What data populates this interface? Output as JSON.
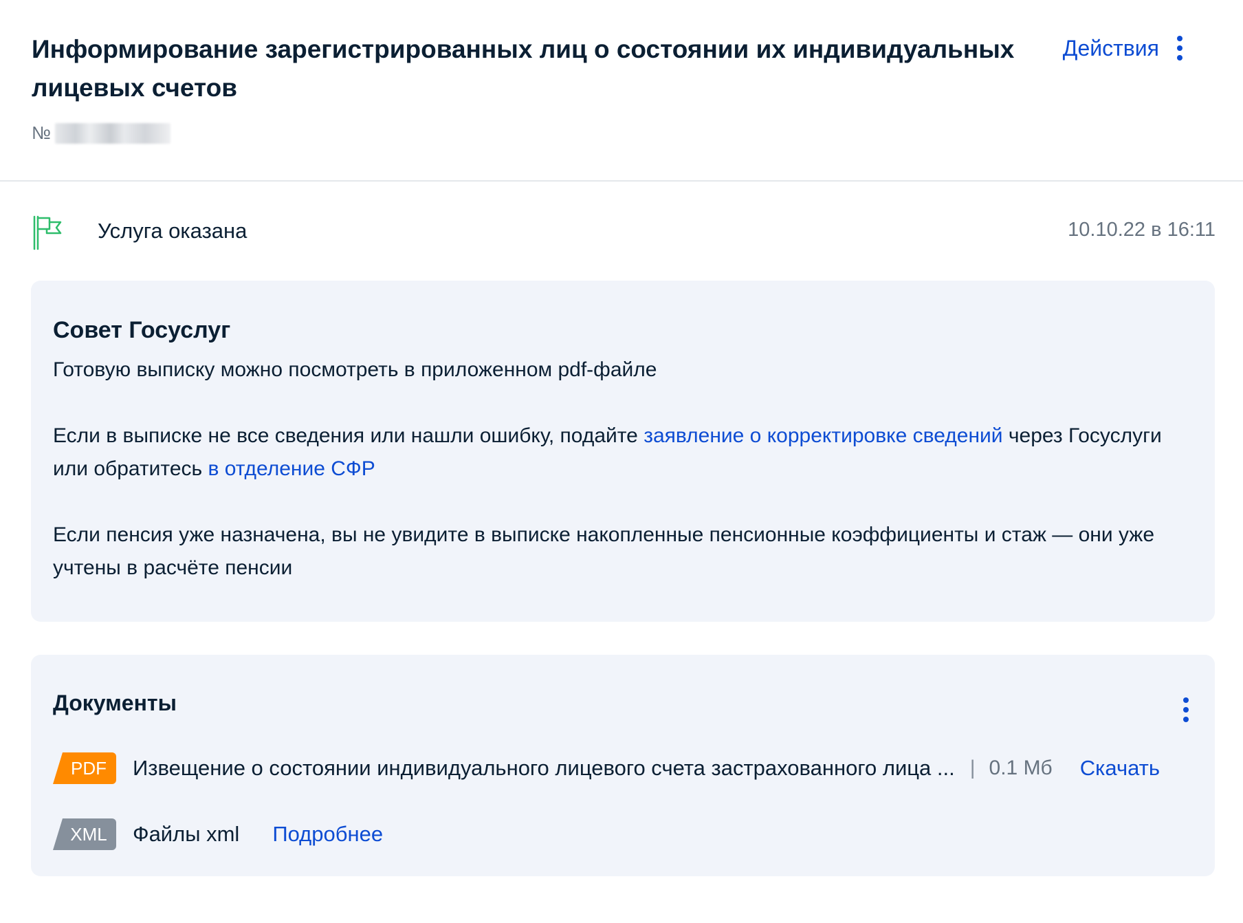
{
  "header": {
    "title": "Информирование зарегистрированных лиц о состоянии их индивидуальных лицевых счетов",
    "number_label": "№",
    "actions_label": "Действия"
  },
  "status": {
    "text": "Услуга оказана",
    "date": "10.10.22 в 16:11",
    "icon": "flag-icon",
    "icon_color": "#2ebd6b"
  },
  "advice": {
    "title": "Совет Госуслуг",
    "p1": "Готовую выписку можно посмотреть в приложенном pdf-файле",
    "p2_before": "Если в выписке не все сведения или нашли ошибку, подайте ",
    "p2_link1": "заявление о корректировке сведений",
    "p2_middle": " через Госуслуги или обратитесь ",
    "p2_link2": "в отделение СФР",
    "p3": "Если пенсия уже назначена, вы не увидите в выписке накопленные пенсионные коэффициенты и стаж — они уже учтены в расчёте пенсии"
  },
  "documents": {
    "title": "Документы",
    "items": [
      {
        "badge": "PDF",
        "name": "Извещение о состоянии индивидуального лицевого счета застрахованного лица ...",
        "separator": "|",
        "size": "0.1 Мб",
        "action": "Скачать",
        "badge_color": "#ff8a00"
      },
      {
        "badge": "XML",
        "name": "Файлы xml",
        "action": "Подробнее",
        "badge_color": "#86909c"
      }
    ]
  },
  "colors": {
    "accent": "#0d4cd3",
    "text": "#0b1f33",
    "muted": "#66727f",
    "card_bg": "#f1f4fa"
  }
}
